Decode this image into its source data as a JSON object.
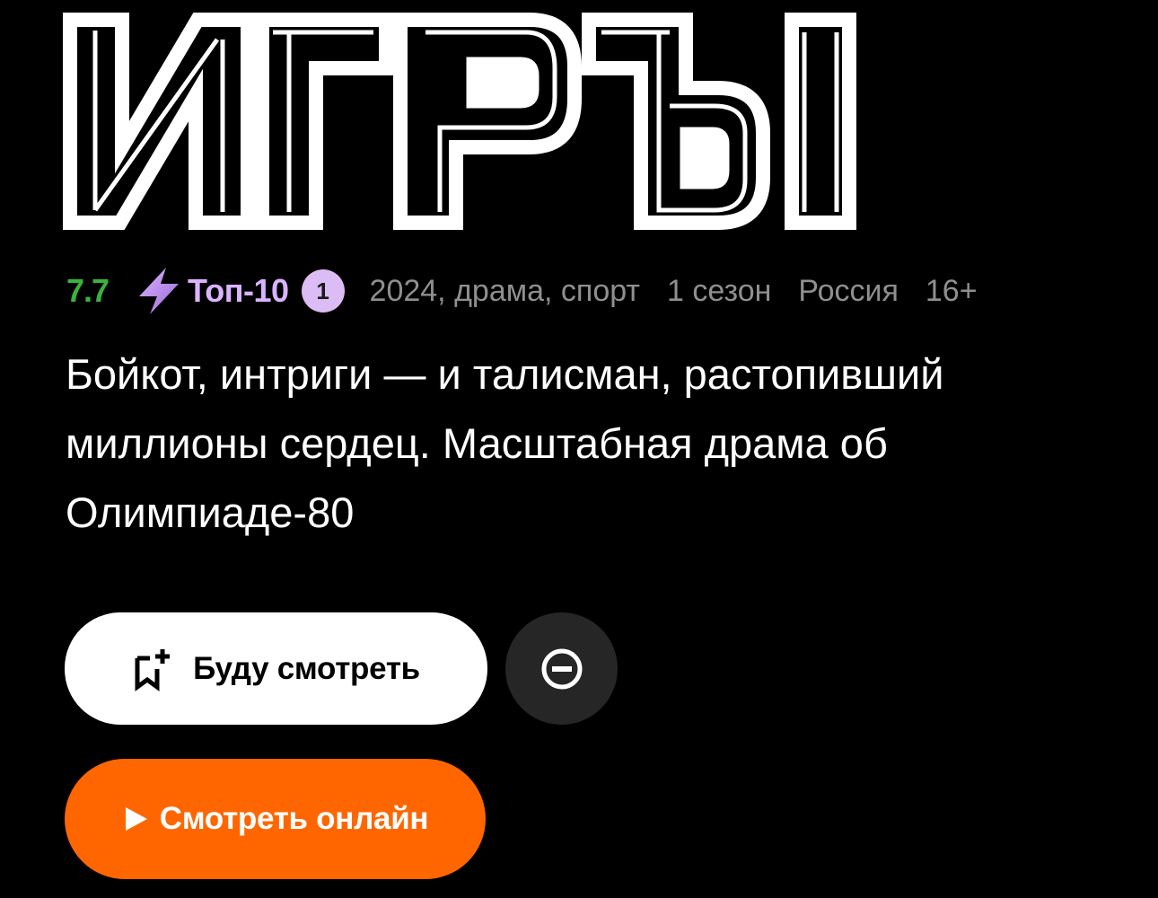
{
  "title": {
    "logo_text": "ИГРЫ"
  },
  "meta": {
    "rating": "7.7",
    "rating_color": "#3bb33b",
    "top_icon": "lightning-bolt-icon",
    "top_label": "Топ-10",
    "top_position": "1",
    "year_genres": "2024, драма, спорт",
    "seasons": "1 сезон",
    "country": "Россия",
    "age_rating": "16+"
  },
  "description": "Бойкот, интриги — и талисман, растопивший миллионы сердец. Масштабная драма об Олимпиаде-80",
  "actions": {
    "watchlist_label": "Буду смотреть",
    "watchlist_icon": "bookmark-plus-icon",
    "hide_icon": "minus-circle-icon",
    "play_label": "Смотреть онлайн",
    "play_icon": "play-icon",
    "play_color": "#ff6600"
  }
}
